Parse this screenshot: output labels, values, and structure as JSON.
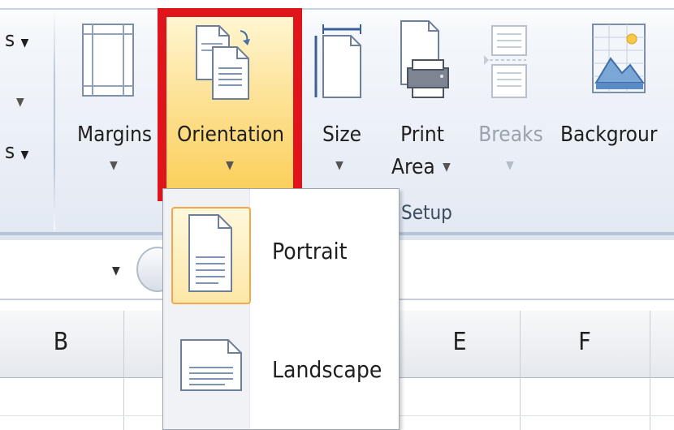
{
  "ribbon": {
    "left_cut_items": [
      "s",
      "",
      "s"
    ],
    "buttons": {
      "margins": "Margins",
      "orientation": "Orientation",
      "size": "Size",
      "print_area_line1": "Print",
      "print_area_line2": "Area",
      "breaks": "Breaks",
      "background": "Backgrour"
    },
    "group_label": "Setup"
  },
  "grid": {
    "columns": [
      "B",
      "E",
      "F"
    ]
  },
  "orientation_menu": {
    "items": [
      {
        "label": "Portrait",
        "selected": true
      },
      {
        "label": "Landscape",
        "selected": false
      }
    ]
  },
  "colors": {
    "highlight_border": "#e0151c",
    "selected_bg": "#fde39a",
    "selected_border": "#f1a74b"
  }
}
